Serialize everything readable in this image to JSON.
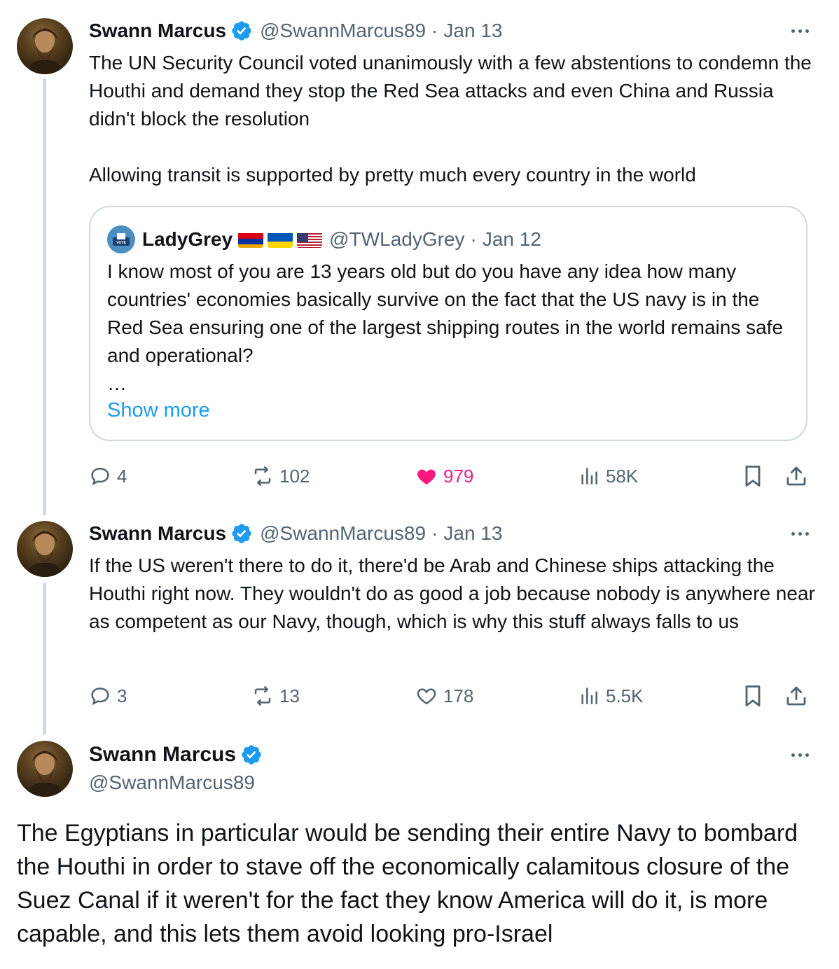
{
  "colors": {
    "text": "#0f1419",
    "muted": "#536471",
    "accent": "#1d9bf0",
    "like": "#f91880",
    "border": "#cfd9de"
  },
  "tweets": [
    {
      "name": "Swann Marcus",
      "handle": "@SwannMarcus89",
      "separator": "·",
      "date": "Jan 13",
      "text": "The UN Security Council voted unanimously with a few abstentions to condemn the Houthi and demand they stop the Red Sea attacks and even China and Russia didn't block the resolution\n\nAllowing transit is supported by pretty much every country in the world",
      "quote": {
        "avatar_label": "VOTE",
        "name": "LadyGrey",
        "flags": [
          "armenia-flag-icon",
          "ukraine-flag-icon",
          "us-flag-icon"
        ],
        "handle": "@TWLadyGrey",
        "separator": "·",
        "date": "Jan 12",
        "text": "I know most of you are 13 years old but do you have any idea how many countries' economies basically survive on the fact that the US navy is in the Red Sea ensuring one of the largest shipping routes in the world remains safe and operational?\n…",
        "show_more": "Show more"
      },
      "actions": {
        "replies": "4",
        "reposts": "102",
        "likes": "979",
        "views": "58K",
        "liked": true
      }
    },
    {
      "name": "Swann Marcus",
      "handle": "@SwannMarcus89",
      "separator": "·",
      "date": "Jan 13",
      "text": "If the US weren't there to do it, there'd be Arab and Chinese ships attacking the Houthi right now. They wouldn't do as good a job because nobody is anywhere near as competent as our Navy, though, which is why this stuff always falls to us",
      "actions": {
        "replies": "3",
        "reposts": "13",
        "likes": "178",
        "views": "5.5K",
        "liked": false
      }
    }
  ],
  "main_tweet": {
    "name": "Swann Marcus",
    "handle": "@SwannMarcus89",
    "text": "The Egyptians in particular would be sending their entire Navy to bombard the Houthi in order to stave off the economically calamitous closure of the Suez Canal if it weren't for the fact they know America will do it, is more capable, and this lets them avoid looking pro-Israel"
  }
}
